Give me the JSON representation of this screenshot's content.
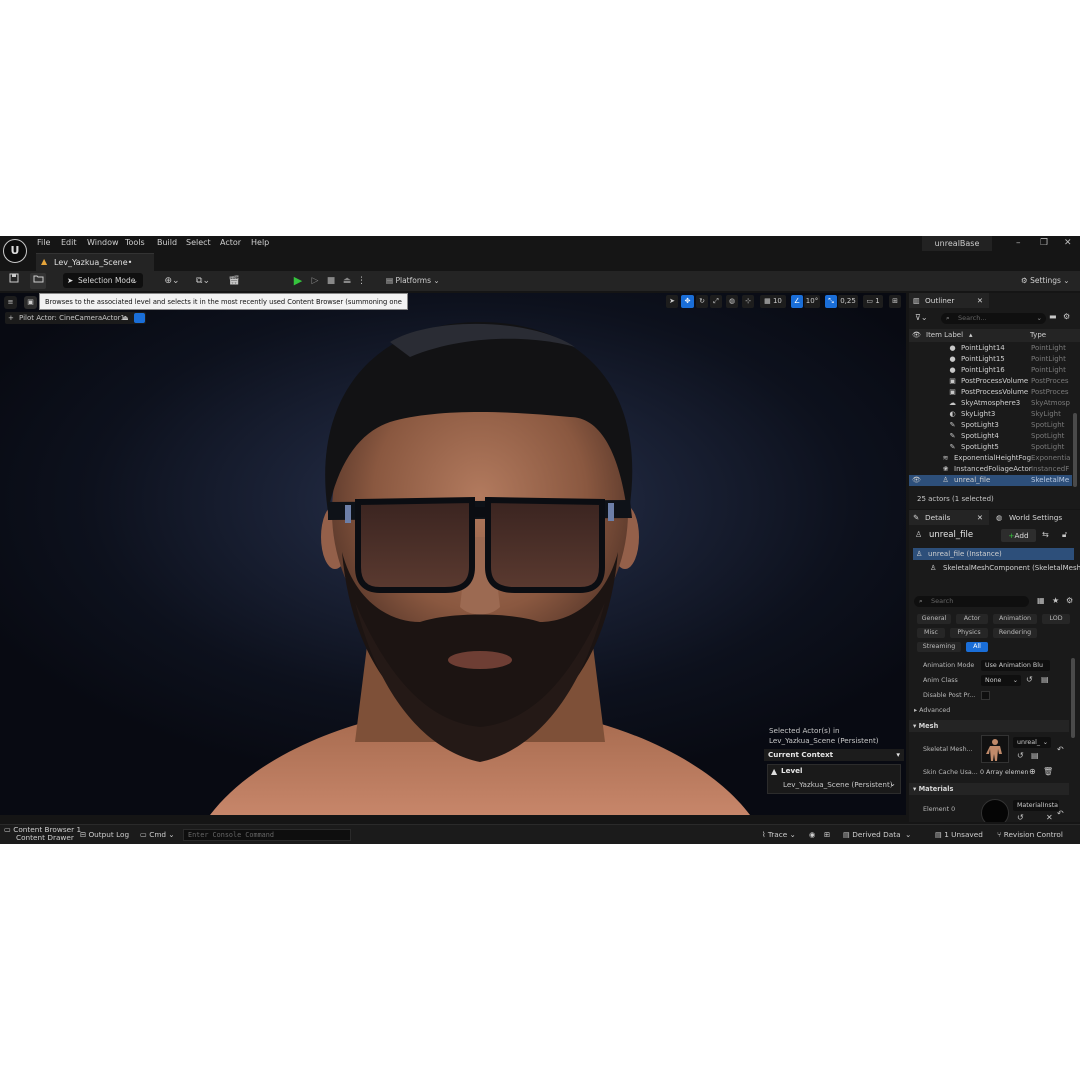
{
  "menu": [
    "File",
    "Edit",
    "Window",
    "Tools",
    "Build",
    "Select",
    "Actor",
    "Help"
  ],
  "window": {
    "project_title": "unrealBase",
    "minimize": "–",
    "maximize": "❐",
    "close": "✕"
  },
  "level_tab": {
    "label": "Lev_Yazkua_Scene•"
  },
  "toolbar": {
    "selection_mode": "Selection Mode",
    "platforms": "Platforms",
    "settings": "Settings"
  },
  "viewport": {
    "tooltip": "Browses to the associated level and selects it in the most recently used Content Browser (summoning one if necessary)",
    "pilot_actor": "Pilot Actor: CineCameraActor1",
    "grid_size": "10",
    "rotation_snap": "10°",
    "scale_snap": "0,25",
    "camera_speed": "1",
    "selected_panel": {
      "selected_in": "Selected Actor(s) in",
      "scene": "Lev_Yazkua_Scene (Persistent)",
      "current_context": "Current Context",
      "level_label": "Level",
      "level_value": "Lev_Yazkua_Scene (Persistent)"
    }
  },
  "bottom": {
    "content_browser": "Content Browser 1",
    "content_drawer": "Content Drawer",
    "output_log": "Output Log",
    "cmd": "Cmd",
    "console_placeholder": "Enter Console Command",
    "trace": "Trace",
    "derived_data": "Derived Data",
    "unsaved": "1 Unsaved",
    "revision_control": "Revision Control"
  },
  "outliner": {
    "tab": "Outliner",
    "search_placeholder": "Search...",
    "col_label": "Item Label",
    "col_type": "Type",
    "rows": [
      {
        "name": "PointLight14",
        "type": "PointLight",
        "icon": "lightbulb-icon"
      },
      {
        "name": "PointLight15",
        "type": "PointLight",
        "icon": "lightbulb-icon"
      },
      {
        "name": "PointLight16",
        "type": "PointLight",
        "icon": "lightbulb-icon"
      },
      {
        "name": "PostProcessVolume",
        "type": "PostProces",
        "icon": "cube-icon"
      },
      {
        "name": "PostProcessVolume",
        "type": "PostProces",
        "icon": "cube-icon"
      },
      {
        "name": "SkyAtmosphere3",
        "type": "SkyAtmosp",
        "icon": "cloud-icon"
      },
      {
        "name": "SkyLight3",
        "type": "SkyLight",
        "icon": "skylight-icon"
      },
      {
        "name": "SpotLight3",
        "type": "SpotLight",
        "icon": "spotlight-icon"
      },
      {
        "name": "SpotLight4",
        "type": "SpotLight",
        "icon": "spotlight-icon"
      },
      {
        "name": "SpotLight5",
        "type": "SpotLight",
        "icon": "spotlight-icon"
      },
      {
        "name": "ExponentialHeightFog",
        "type": "Exponential",
        "icon": "fog-icon"
      },
      {
        "name": "InstancedFoliageActor",
        "type": "InstancedF",
        "icon": "foliage-icon"
      },
      {
        "name": "unreal_file",
        "type": "SkeletalMe",
        "icon": "skeleton-icon",
        "selected": true
      }
    ],
    "status": "25 actors (1 selected)"
  },
  "details": {
    "tab": "Details",
    "world_settings_tab": "World Settings",
    "actor_name": "unreal_file",
    "add_label": "Add",
    "components": [
      "unreal_file (Instance)",
      "SkeletalMeshComponent (SkeletalMesh"
    ],
    "search_placeholder": "Search",
    "filters": [
      "General",
      "Actor",
      "Animation",
      "LOD",
      "Misc",
      "Physics",
      "Rendering",
      "Streaming",
      "All"
    ],
    "props": {
      "anim_mode_label": "Animation Mode",
      "anim_mode_value": "Use Animation Blu",
      "anim_class_label": "Anim Class",
      "anim_class_value": "None",
      "disable_post_label": "Disable Post Pr...",
      "advanced_label": "Advanced",
      "mesh_section": "Mesh",
      "skeletal_mesh_label": "Skeletal Mesh...",
      "skeletal_mesh_value": "unreal_",
      "skin_cache_label": "Skin Cache Usa...",
      "skin_cache_value": "0 Array elemen",
      "materials_section": "Materials",
      "element0_label": "Element 0",
      "element0_value": "MaterialInsta"
    }
  },
  "colors": {
    "accent": "#1a6ed8",
    "play": "#35c43d",
    "selection": "#2d4f7a"
  }
}
